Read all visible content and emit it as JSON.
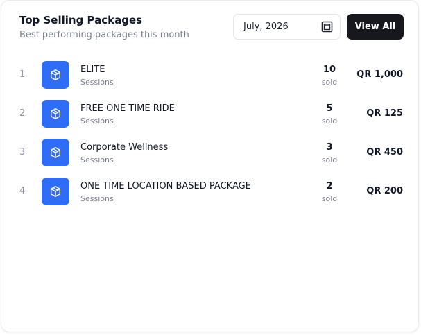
{
  "header": {
    "title": "Top Selling Packages",
    "subtitle": "Best performing packages this month"
  },
  "date_picker": {
    "value": "July, 2026",
    "icon": "calendar-icon"
  },
  "view_all_label": "View All",
  "colors": {
    "accent": "#2f6df6",
    "button_bg": "#16181d"
  },
  "packages": [
    {
      "rank": "1",
      "name": "ELITE",
      "type": "Sessions",
      "count": "10",
      "sold_label": "sold",
      "price": "QR 1,000",
      "icon": "package-box-icon"
    },
    {
      "rank": "2",
      "name": "FREE ONE TIME RIDE",
      "type": "Sessions",
      "count": "5",
      "sold_label": "sold",
      "price": "QR 125",
      "icon": "package-box-icon"
    },
    {
      "rank": "3",
      "name": "Corporate Wellness",
      "type": "Sessions",
      "count": "3",
      "sold_label": "sold",
      "price": "QR 450",
      "icon": "package-box-icon"
    },
    {
      "rank": "4",
      "name": "ONE TIME LOCATION BASED PACKAGE",
      "type": "Sessions",
      "count": "2",
      "sold_label": "sold",
      "price": "QR 200",
      "icon": "package-box-icon"
    }
  ]
}
